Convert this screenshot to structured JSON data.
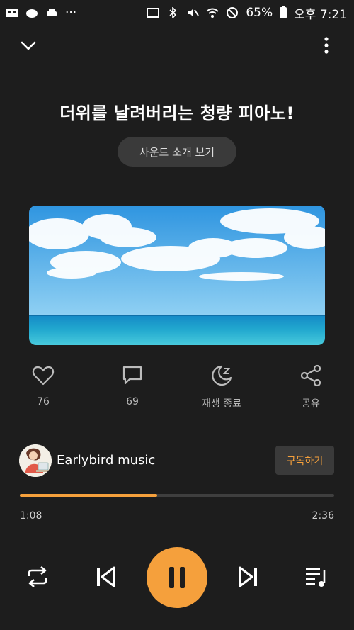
{
  "status_bar": {
    "battery_text": "65%",
    "time_text": "오후 7:21",
    "more_dots": "···"
  },
  "player": {
    "title": "더위를 날려버리는 청량 피아노!",
    "intro_button": "사운드 소개 보기",
    "actions": [
      {
        "icon": "heart-icon",
        "label": "76"
      },
      {
        "icon": "comment-icon",
        "label": "69"
      },
      {
        "icon": "sleep-timer-icon",
        "label": "재생 종료"
      },
      {
        "icon": "share-icon",
        "label": "공유"
      }
    ],
    "channel": {
      "name": "Earlybird music",
      "subscribe_label": "구독하기"
    },
    "progress": {
      "current": "1:08",
      "total": "2:36",
      "fraction": 0.436
    }
  },
  "colors": {
    "background": "#1d1d1d",
    "accent": "#f5a03c",
    "button_bg": "#3a3a3a"
  }
}
